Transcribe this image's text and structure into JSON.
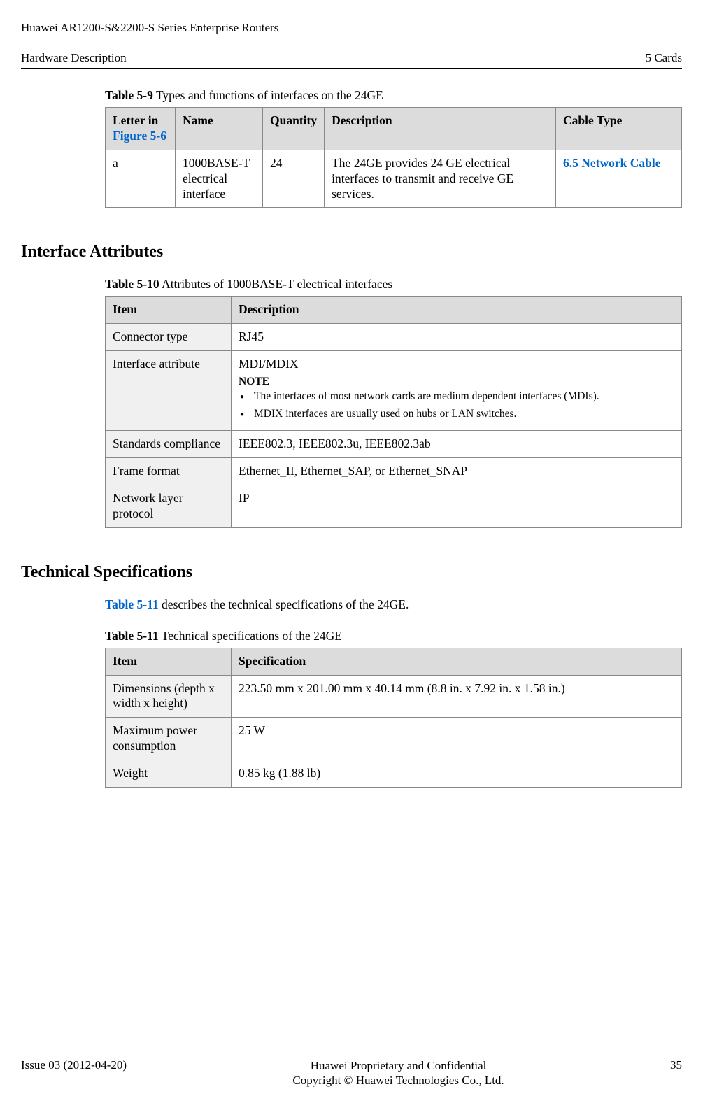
{
  "header": {
    "product_line1": "Huawei AR1200-S&2200-S Series Enterprise Routers",
    "product_line2": "Hardware Description",
    "chapter": "5 Cards"
  },
  "table59": {
    "caption_label": "Table 5-9",
    "caption_text": " Types and functions of interfaces on the 24GE",
    "headers": {
      "letter_a": "Letter in ",
      "letter_b": "Figure 5-6",
      "name": "Name",
      "qty": "Quantity",
      "desc": "Description",
      "cable": "Cable Type"
    },
    "row1": {
      "letter": "a",
      "name": "1000BASE-T electrical interface",
      "qty": "24",
      "desc": "The 24GE provides 24 GE electrical interfaces to transmit and receive GE services.",
      "cable": "6.5 Network Cable"
    }
  },
  "section1": {
    "heading": "Interface Attributes"
  },
  "table510": {
    "caption_label": "Table 5-10",
    "caption_text": " Attributes of 1000BASE-T electrical interfaces",
    "h_item": "Item",
    "h_desc": "Description",
    "r1_item": "Connector type",
    "r1_desc": "RJ45",
    "r2_item": "Interface attribute",
    "r2_line1": "MDI/MDIX",
    "r2_note_label": "NOTE",
    "r2_note1": "The interfaces of most network cards are medium dependent interfaces (MDIs).",
    "r2_note2": "MDIX interfaces are usually used on hubs or LAN switches.",
    "r3_item": "Standards compliance",
    "r3_desc": "IEEE802.3, IEEE802.3u, IEEE802.3ab",
    "r4_item": "Frame format",
    "r4_desc": "Ethernet_II, Ethernet_SAP, or Ethernet_SNAP",
    "r5_item": "Network layer protocol",
    "r5_desc": "IP"
  },
  "section2": {
    "heading": "Technical Specifications",
    "intro_a": "Table 5-11",
    "intro_b": " describes the technical specifications of the 24GE."
  },
  "table511": {
    "caption_label": "Table 5-11",
    "caption_text": " Technical specifications of the 24GE",
    "h_item": "Item",
    "h_spec": "Specification",
    "r1_item": "Dimensions (depth x width x height)",
    "r1_spec": "223.50 mm x 201.00 mm x 40.14 mm (8.8 in. x 7.92 in. x 1.58 in.)",
    "r2_item": "Maximum power consumption",
    "r2_spec": "25 W",
    "r3_item": "Weight",
    "r3_spec": "0.85 kg (1.88 lb)"
  },
  "footer": {
    "left": "Issue 03 (2012-04-20)",
    "center1": "Huawei Proprietary and Confidential",
    "center2": "Copyright © Huawei Technologies Co., Ltd.",
    "right": "35"
  }
}
